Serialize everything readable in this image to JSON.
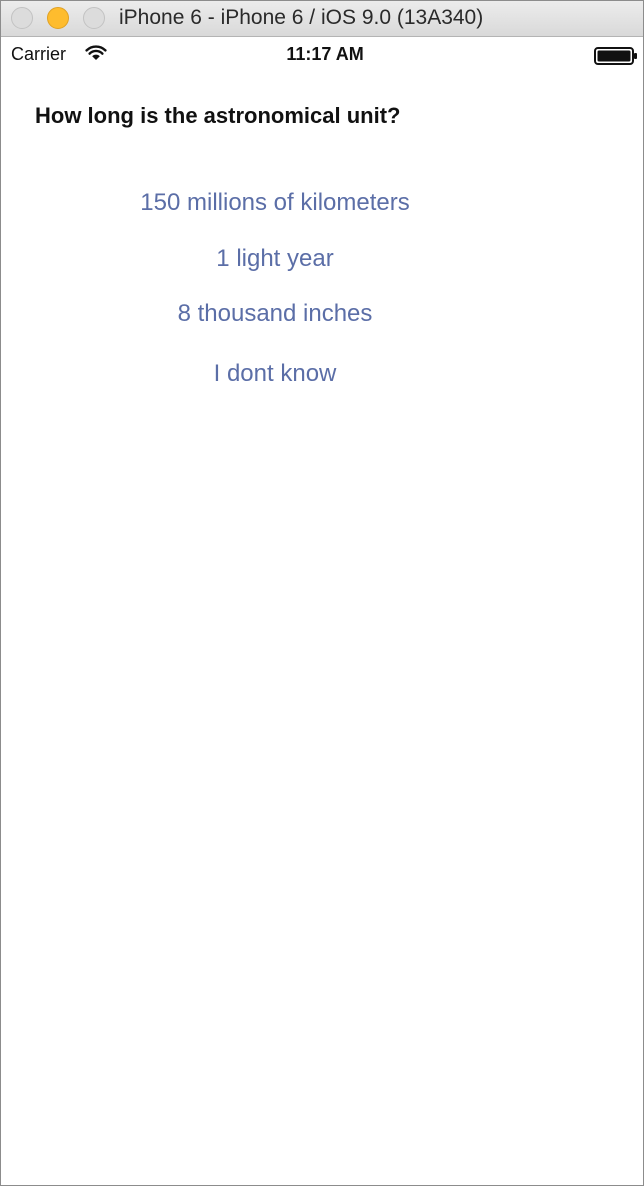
{
  "window": {
    "title": "iPhone 6 - iPhone 6 / iOS 9.0 (13A340)"
  },
  "status_bar": {
    "carrier": "Carrier",
    "time": "11:17 AM",
    "wifi_icon": "wifi-icon",
    "battery_icon": "battery-icon"
  },
  "quiz": {
    "question": "How long is the astronomical unit?",
    "answers": [
      "150 millions of kilometers",
      "1 light year",
      "8 thousand inches",
      "I dont know"
    ]
  },
  "colors": {
    "answer_text": "#5b6ea7",
    "question_text": "#111111",
    "minimize_button": "#febc2e"
  }
}
